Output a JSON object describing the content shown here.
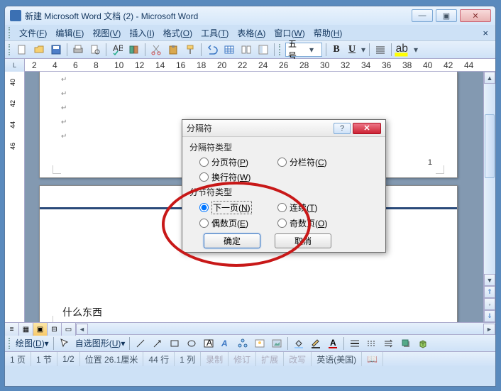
{
  "titlebar": {
    "title": "新建 Microsoft Word 文档 (2) - Microsoft Word"
  },
  "winbtns": {
    "min": "—",
    "max": "▣",
    "close": "✕"
  },
  "menu": [
    {
      "label": "文件",
      "key": "F"
    },
    {
      "label": "编辑",
      "key": "E"
    },
    {
      "label": "视图",
      "key": "V"
    },
    {
      "label": "插入",
      "key": "I"
    },
    {
      "label": "格式",
      "key": "O"
    },
    {
      "label": "工具",
      "key": "T"
    },
    {
      "label": "表格",
      "key": "A"
    },
    {
      "label": "窗口",
      "key": "W"
    },
    {
      "label": "帮助",
      "key": "H"
    }
  ],
  "font": {
    "size": "五号"
  },
  "ruler_h": [
    "2",
    "4",
    "6",
    "8",
    "10",
    "12",
    "14",
    "16",
    "18",
    "20",
    "22",
    "24",
    "26",
    "28",
    "30",
    "32",
    "34",
    "36",
    "38",
    "40",
    "42",
    "44"
  ],
  "ruler_v": [
    "40",
    "42",
    "44",
    "46"
  ],
  "doc": {
    "text": "什么东西",
    "pnum": "1"
  },
  "dialog": {
    "title": "分隔符",
    "g1": "分隔符类型",
    "opts1": [
      {
        "label": "分页符",
        "k": "P"
      },
      {
        "label": "分栏符",
        "k": "C"
      },
      {
        "label": "换行符",
        "k": "W"
      }
    ],
    "g2": "分节符类型",
    "opts2": [
      {
        "label": "下一页",
        "k": "N"
      },
      {
        "label": "连续",
        "k": "T"
      },
      {
        "label": "偶数页",
        "k": "E"
      },
      {
        "label": "奇数页",
        "k": "O"
      }
    ],
    "ok": "确定",
    "cancel": "取消",
    "help": "?",
    "close": "✕"
  },
  "drawbar": {
    "label": "绘图",
    "key": "D",
    "autoshape": "自选图形",
    "akey": "U"
  },
  "status": {
    "page": "1 页",
    "sec": "1 节",
    "pages": "1/2",
    "pos": "位置 26.1厘米",
    "line": "44 行",
    "col": "1 列",
    "rec": "录制",
    "rev": "修订",
    "ext": "扩展",
    "ovr": "改写",
    "lang": "英语(美国)"
  }
}
